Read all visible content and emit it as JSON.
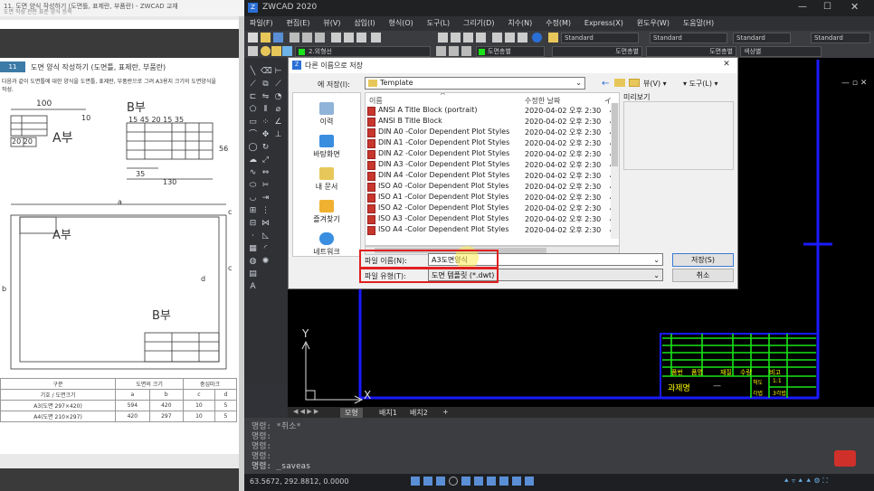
{
  "doc": {
    "title": "11. 도면 양식 작성하기 (도면틀, 표제란, 부품란) - ZWCAD 교재",
    "header_line": "도면 작성 관련 표준 양식 등록",
    "section_num": "11",
    "section_title": "도면 양식 작성하기 (도면틀, 표제란, 부품란)",
    "intro": "다음과 같이 도면틀에 대한 양식을 도면틀, 표제란, 부품란으로 그려 A3용지 크기의 도면양식을",
    "intro2": "작성.",
    "dim_100": "100",
    "label_b": "B부",
    "label_a": "A부",
    "dims_top": "15  45  20 15  35",
    "dim_56": "56",
    "dim_35": "35",
    "dim_130": "130",
    "dim_20": "20 20",
    "dim_10": "10",
    "dim_a": "a",
    "dim_c": "c",
    "dim_d": "d",
    "dim_b": "b",
    "label_a2": "A부",
    "label_b2": "B부",
    "table": {
      "headers": [
        "구분",
        "도면의 크기",
        "",
        "중심마크"
      ],
      "subheaders": [
        "기호 / 도면크기",
        "a",
        "b",
        "c",
        "d"
      ],
      "rows": [
        [
          "A3(도면 297×420)",
          "594",
          "420",
          "10",
          "5"
        ],
        [
          "A4(도면 210×297)",
          "420",
          "297",
          "10",
          "5"
        ]
      ]
    }
  },
  "app": {
    "title": "ZWCAD 2020",
    "menu": [
      "파일(F)",
      "편집(E)",
      "뷰(V)",
      "삽입(I)",
      "형식(O)",
      "도구(L)",
      "그리기(D)",
      "치수(N)",
      "수정(M)",
      "Express(X)",
      "윈도우(W)",
      "도움말(H)"
    ],
    "toolbar_combos": {
      "textstyle": "Standard",
      "dimstyle": "Standard",
      "tablestyle": "Standard",
      "mlstyle": "Standard",
      "layer": "2.외형선",
      "layer_color": "도면층별",
      "linetype": "도면층별",
      "lineweight": "도면층별",
      "plotstyle": "색상별"
    },
    "layout_tabs": [
      "모형",
      "배치1",
      "배치2",
      "+"
    ],
    "command_lines": [
      "명령: *취소*",
      "명령:",
      "명령:",
      "명령:",
      "명령: _saveas"
    ],
    "coordinates": "63.5672, 292.8812, 0.0000",
    "canvas": {
      "title_block": {
        "cells_left": "과제명",
        "cells_dash": "—",
        "small_labels": [
          "품번",
          "품명",
          "재질",
          "수량",
          "비고"
        ],
        "small2": [
          "척도",
          "1:1"
        ],
        "small3": [
          "각법",
          "3각법"
        ]
      }
    },
    "ucs": {
      "y": "Y",
      "x": "X"
    }
  },
  "dialog": {
    "title": "다른 이름으로 저장",
    "save_in_label": "에 저장(I):",
    "save_in_value": "Template",
    "nav_view": "뷰(V)",
    "nav_tools": "도구(L)",
    "sidebar": [
      "이력",
      "바탕화면",
      "내 문서",
      "즐겨찾기",
      "네트워크"
    ],
    "columns": {
      "name": "이름",
      "date": "수정한 날짜",
      "extra": "イ"
    },
    "preview_label": "미리보기",
    "files": [
      {
        "name": "ANSI A Title Block (portrait)",
        "date": "2020-04-02 오후 2:30",
        "extra": "A"
      },
      {
        "name": "ANSI B Title Block",
        "date": "2020-04-02 오후 2:30",
        "extra": "A"
      },
      {
        "name": "DIN A0 -Color Dependent Plot Styles",
        "date": "2020-04-02 오후 2:30",
        "extra": "A"
      },
      {
        "name": "DIN A1 -Color Dependent Plot Styles",
        "date": "2020-04-02 오후 2:30",
        "extra": "A"
      },
      {
        "name": "DIN A2 -Color Dependent Plot Styles",
        "date": "2020-04-02 오후 2:30",
        "extra": "A"
      },
      {
        "name": "DIN A3 -Color Dependent Plot Styles",
        "date": "2020-04-02 오후 2:30",
        "extra": "A"
      },
      {
        "name": "DIN A4 -Color Dependent Plot Styles",
        "date": "2020-04-02 오후 2:30",
        "extra": "A"
      },
      {
        "name": "ISO A0 -Color Dependent Plot Styles",
        "date": "2020-04-02 오후 2:30",
        "extra": "A"
      },
      {
        "name": "ISO A1 -Color Dependent Plot Styles",
        "date": "2020-04-02 오후 2:30",
        "extra": "A"
      },
      {
        "name": "ISO A2 -Color Dependent Plot Styles",
        "date": "2020-04-02 오후 2:30",
        "extra": "A"
      },
      {
        "name": "ISO A3 -Color Dependent Plot Styles",
        "date": "2020-04-02 오후 2:30",
        "extra": "A"
      },
      {
        "name": "ISO A4 -Color Dependent Plot Styles",
        "date": "2020-04-02 오후 2:30",
        "extra": "A"
      }
    ],
    "filename_label": "파일 이름(N):",
    "filename_value": "A3도면양식",
    "filetype_label": "파일 유형(T):",
    "filetype_value": "도면 템플릿 (*.dwt)",
    "save_button": "저장(S)",
    "cancel_button": "취소"
  },
  "colors": {
    "canvas_bg": "#000000",
    "frame_blue": "#1a1aff",
    "title_green": "#19e319",
    "title_yellow": "#ffff00",
    "highlight_red": "#e02020"
  }
}
